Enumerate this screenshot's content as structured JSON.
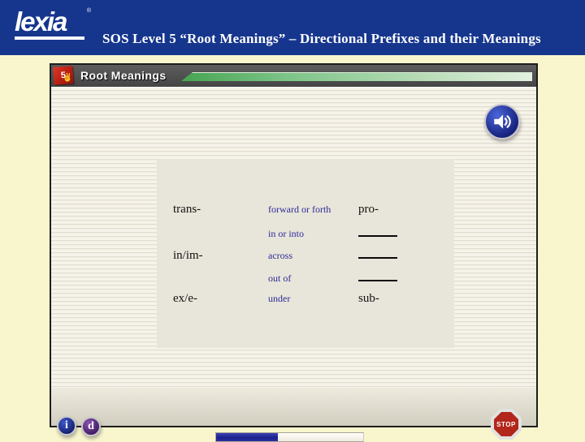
{
  "header": {
    "logo": "lexia",
    "trademark": "®",
    "title": "SOS Level 5 “Root Meanings” – Directional Prefixes and their Meanings",
    "background_color": "#16368e"
  },
  "window": {
    "level": "5",
    "title": "Root Meanings",
    "titlebar_color": "#4e4e4e",
    "progress_strip_color": "#46a451"
  },
  "table": {
    "rows": [
      {
        "prefix_left": "trans-",
        "meaning": "forward or forth",
        "prefix_right": "pro-"
      },
      {
        "prefix_left": "",
        "meaning": "in or into",
        "prefix_right": ""
      },
      {
        "prefix_left": "in/im-",
        "meaning": "across",
        "prefix_right": ""
      },
      {
        "prefix_left": "",
        "meaning": "out of",
        "prefix_right": ""
      },
      {
        "prefix_left": "ex/e-",
        "meaning": "under",
        "prefix_right": "sub-"
      }
    ],
    "meaning_text_color": "#2c2c99"
  },
  "footer": {
    "info_label": "i",
    "directions_label": "d",
    "stop_label": "STOP",
    "progress_percent": 42,
    "progress_fill_color": "#242a9e",
    "stop_color": "#b2261b"
  }
}
